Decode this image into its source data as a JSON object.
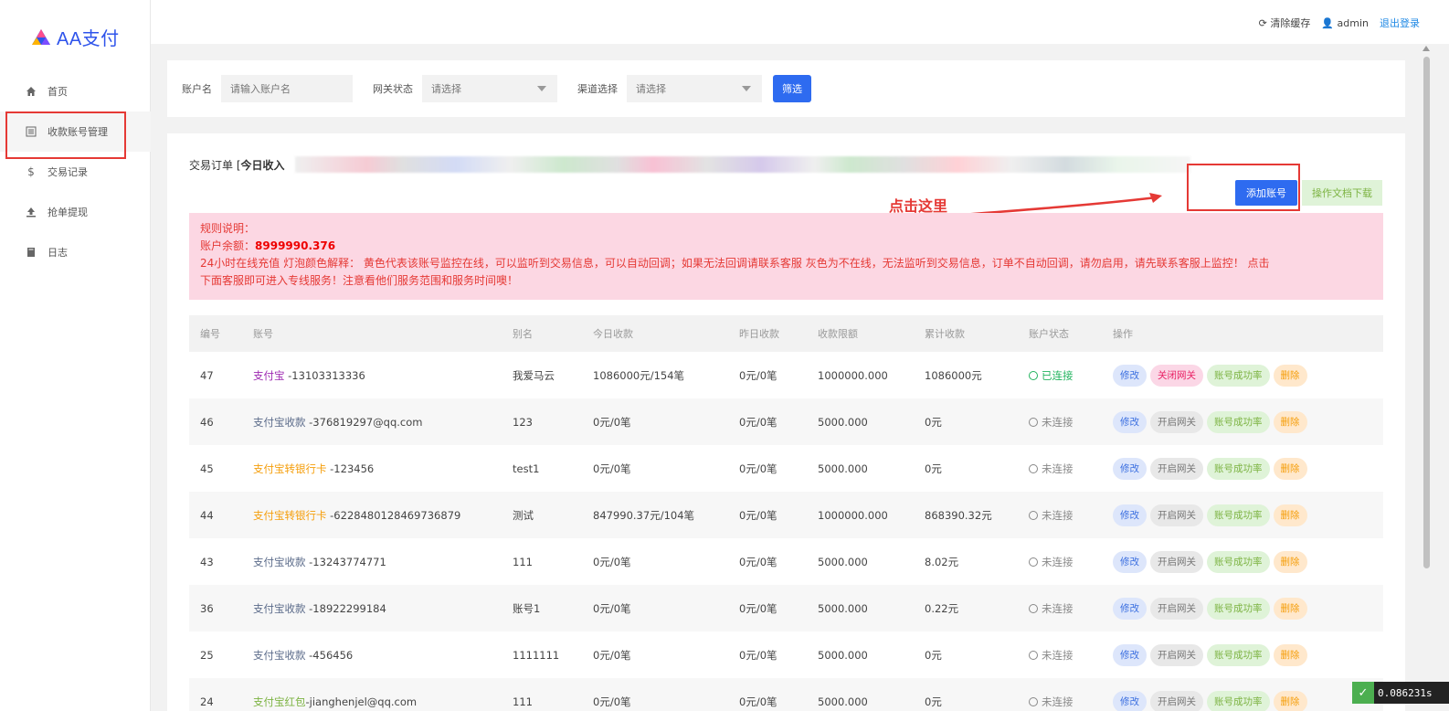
{
  "app": {
    "title": "AA支付"
  },
  "sidebar": {
    "items": [
      {
        "label": "首页",
        "icon": "home-icon"
      },
      {
        "label": "收款账号管理",
        "icon": "list-icon"
      },
      {
        "label": "交易记录",
        "icon": "dollar-icon"
      },
      {
        "label": "抢单提现",
        "icon": "upload-icon"
      },
      {
        "label": "日志",
        "icon": "book-icon"
      }
    ]
  },
  "topbar": {
    "clear_cache": "清除缓存",
    "user": "admin",
    "logout": "退出登录"
  },
  "filter": {
    "account_label": "账户名",
    "account_placeholder": "请输入账户名",
    "gateway_label": "网关状态",
    "gateway_value": "请选择",
    "channel_label": "渠道选择",
    "channel_value": "请选择",
    "submit": "筛选"
  },
  "orders": {
    "label": "交易订单 [",
    "today_income": "今日收入"
  },
  "annotation": {
    "text": "点击这里"
  },
  "buttons": {
    "add_account": "添加账号",
    "doc_download": "操作文档下载"
  },
  "notice": {
    "title": "规则说明：",
    "balance_label": "账户余额：",
    "balance_value": "8999990.376",
    "line3": "24小时在线充值 灯泡颜色解释： 黄色代表该账号监控在线，可以监听到交易信息，可以自动回调；如果无法回调请联系客服 灰色为不在线，无法监听到交易信息，订单不自动回调，请勿启用，请先联系客服上监控！ 点击",
    "line4": "下面客服即可进入专线服务！注意看他们服务范围和服务时间噢！"
  },
  "table": {
    "headers": [
      "编号",
      "账号",
      "别名",
      "今日收款",
      "昨日收款",
      "收款限额",
      "累计收款",
      "账户状态",
      "操作"
    ],
    "rows": [
      {
        "id": "47",
        "channel": "支付宝",
        "channel_color": "purple",
        "account": " -13103313336",
        "alias": "我爱马云",
        "today": "1086000元/154笔",
        "yesterday": "0元/0笔",
        "limit": "1000000.000",
        "total": "1086000元",
        "status": "已连接",
        "status_on": true,
        "gateway_btn": "关闭网关"
      },
      {
        "id": "46",
        "channel": "支付宝收款",
        "channel_color": "blue",
        "account": " -376819297@qq.com",
        "alias": "123",
        "today": "0元/0笔",
        "yesterday": "0元/0笔",
        "limit": "5000.000",
        "total": "0元",
        "status": "未连接",
        "status_on": false,
        "gateway_btn": "开启网关"
      },
      {
        "id": "45",
        "channel": "支付宝转银行卡",
        "channel_color": "orange",
        "account": " -123456",
        "alias": "test1",
        "today": "0元/0笔",
        "yesterday": "0元/0笔",
        "limit": "5000.000",
        "total": "0元",
        "status": "未连接",
        "status_on": false,
        "gateway_btn": "开启网关"
      },
      {
        "id": "44",
        "channel": "支付宝转银行卡",
        "channel_color": "orange",
        "account": " -6228480128469736879",
        "alias": "测试",
        "today": "847990.37元/104笔",
        "yesterday": "0元/0笔",
        "limit": "1000000.000",
        "total": "868390.32元",
        "status": "未连接",
        "status_on": false,
        "gateway_btn": "开启网关"
      },
      {
        "id": "43",
        "channel": "支付宝收款",
        "channel_color": "blue",
        "account": " -13243774771",
        "alias": "111",
        "today": "0元/0笔",
        "yesterday": "0元/0笔",
        "limit": "5000.000",
        "total": "8.02元",
        "status": "未连接",
        "status_on": false,
        "gateway_btn": "开启网关"
      },
      {
        "id": "36",
        "channel": "支付宝收款",
        "channel_color": "blue",
        "account": " -18922299184",
        "alias": "账号1",
        "today": "0元/0笔",
        "yesterday": "0元/0笔",
        "limit": "5000.000",
        "total": "0.22元",
        "status": "未连接",
        "status_on": false,
        "gateway_btn": "开启网关"
      },
      {
        "id": "25",
        "channel": "支付宝收款",
        "channel_color": "blue",
        "account": " -456456",
        "alias": "1111111",
        "today": "0元/0笔",
        "yesterday": "0元/0笔",
        "limit": "5000.000",
        "total": "0元",
        "status": "未连接",
        "status_on": false,
        "gateway_btn": "开启网关"
      },
      {
        "id": "24",
        "channel": "支付宝红包",
        "channel_color": "green",
        "account": "-jianghenjel@qq.com",
        "alias": "111",
        "today": "0元/0笔",
        "yesterday": "0元/0笔",
        "limit": "5000.000",
        "total": "0元",
        "status": "未连接",
        "status_on": false,
        "gateway_btn": "开启网关"
      }
    ],
    "actions": {
      "edit": "修改",
      "rate": "账号成功率",
      "delete": "删除"
    }
  },
  "timer": {
    "value": "0.086231s"
  }
}
